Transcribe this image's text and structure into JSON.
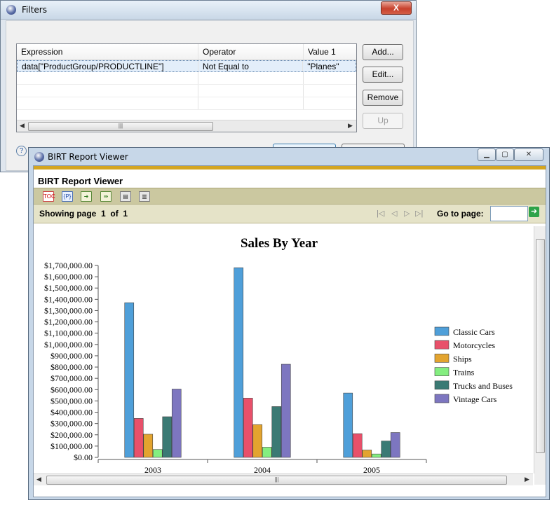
{
  "filters_dialog": {
    "title": "Filters",
    "close_label": "X",
    "columns": [
      "Expression",
      "Operator",
      "Value 1"
    ],
    "rows": [
      {
        "expression": "data[\"ProductGroup/PRODUCTLINE\"]",
        "operator": "Not Equal to",
        "value": "\"Planes\""
      }
    ],
    "buttons": {
      "add": "Add...",
      "edit": "Edit...",
      "remove": "Remove",
      "up": "Up"
    },
    "help_label": "?"
  },
  "birt_window": {
    "title": "BIRT Report Viewer",
    "header_title": "BIRT Report Viewer",
    "toolbar_icons": [
      "toc-icon",
      "parameters-icon",
      "export-data-icon",
      "export-report-icon",
      "print-icon",
      "print-server-icon"
    ],
    "navigation": {
      "showing_label": "Showing page",
      "current_page": "1",
      "of_label": "of",
      "total_pages": "1",
      "goto_label": "Go to page:",
      "goto_value": ""
    }
  },
  "chart_data": {
    "type": "bar",
    "title": "Sales By Year",
    "categories": [
      "2003",
      "2004",
      "2005"
    ],
    "ylim": [
      0,
      1700000
    ],
    "ytick_labels": [
      "$0.00",
      "$100,000.00",
      "$200,000.00",
      "$300,000.00",
      "$400,000.00",
      "$500,000.00",
      "$600,000.00",
      "$700,000.00",
      "$800,000.00",
      "$900,000.00",
      "$1,000,000.00",
      "$1,100,000.00",
      "$1,200,000.00",
      "$1,300,000.00",
      "$1,400,000.00",
      "$1,500,000.00",
      "$1,600,000.00",
      "$1,700,000.00"
    ],
    "legend_position": "right",
    "series": [
      {
        "name": "Classic Cars",
        "color": "#4f9fd9",
        "values": [
          1370000,
          1680000,
          570000
        ]
      },
      {
        "name": "Motorcycles",
        "color": "#e8506a",
        "values": [
          345000,
          525000,
          210000
        ]
      },
      {
        "name": "Ships",
        "color": "#e3a42f",
        "values": [
          205000,
          290000,
          65000
        ]
      },
      {
        "name": "Trains",
        "color": "#84ee80",
        "values": [
          70000,
          90000,
          30000
        ]
      },
      {
        "name": "Trucks and Buses",
        "color": "#3b7a74",
        "values": [
          360000,
          450000,
          145000
        ]
      },
      {
        "name": "Vintage Cars",
        "color": "#7d76c0",
        "values": [
          605000,
          825000,
          220000
        ]
      }
    ]
  }
}
